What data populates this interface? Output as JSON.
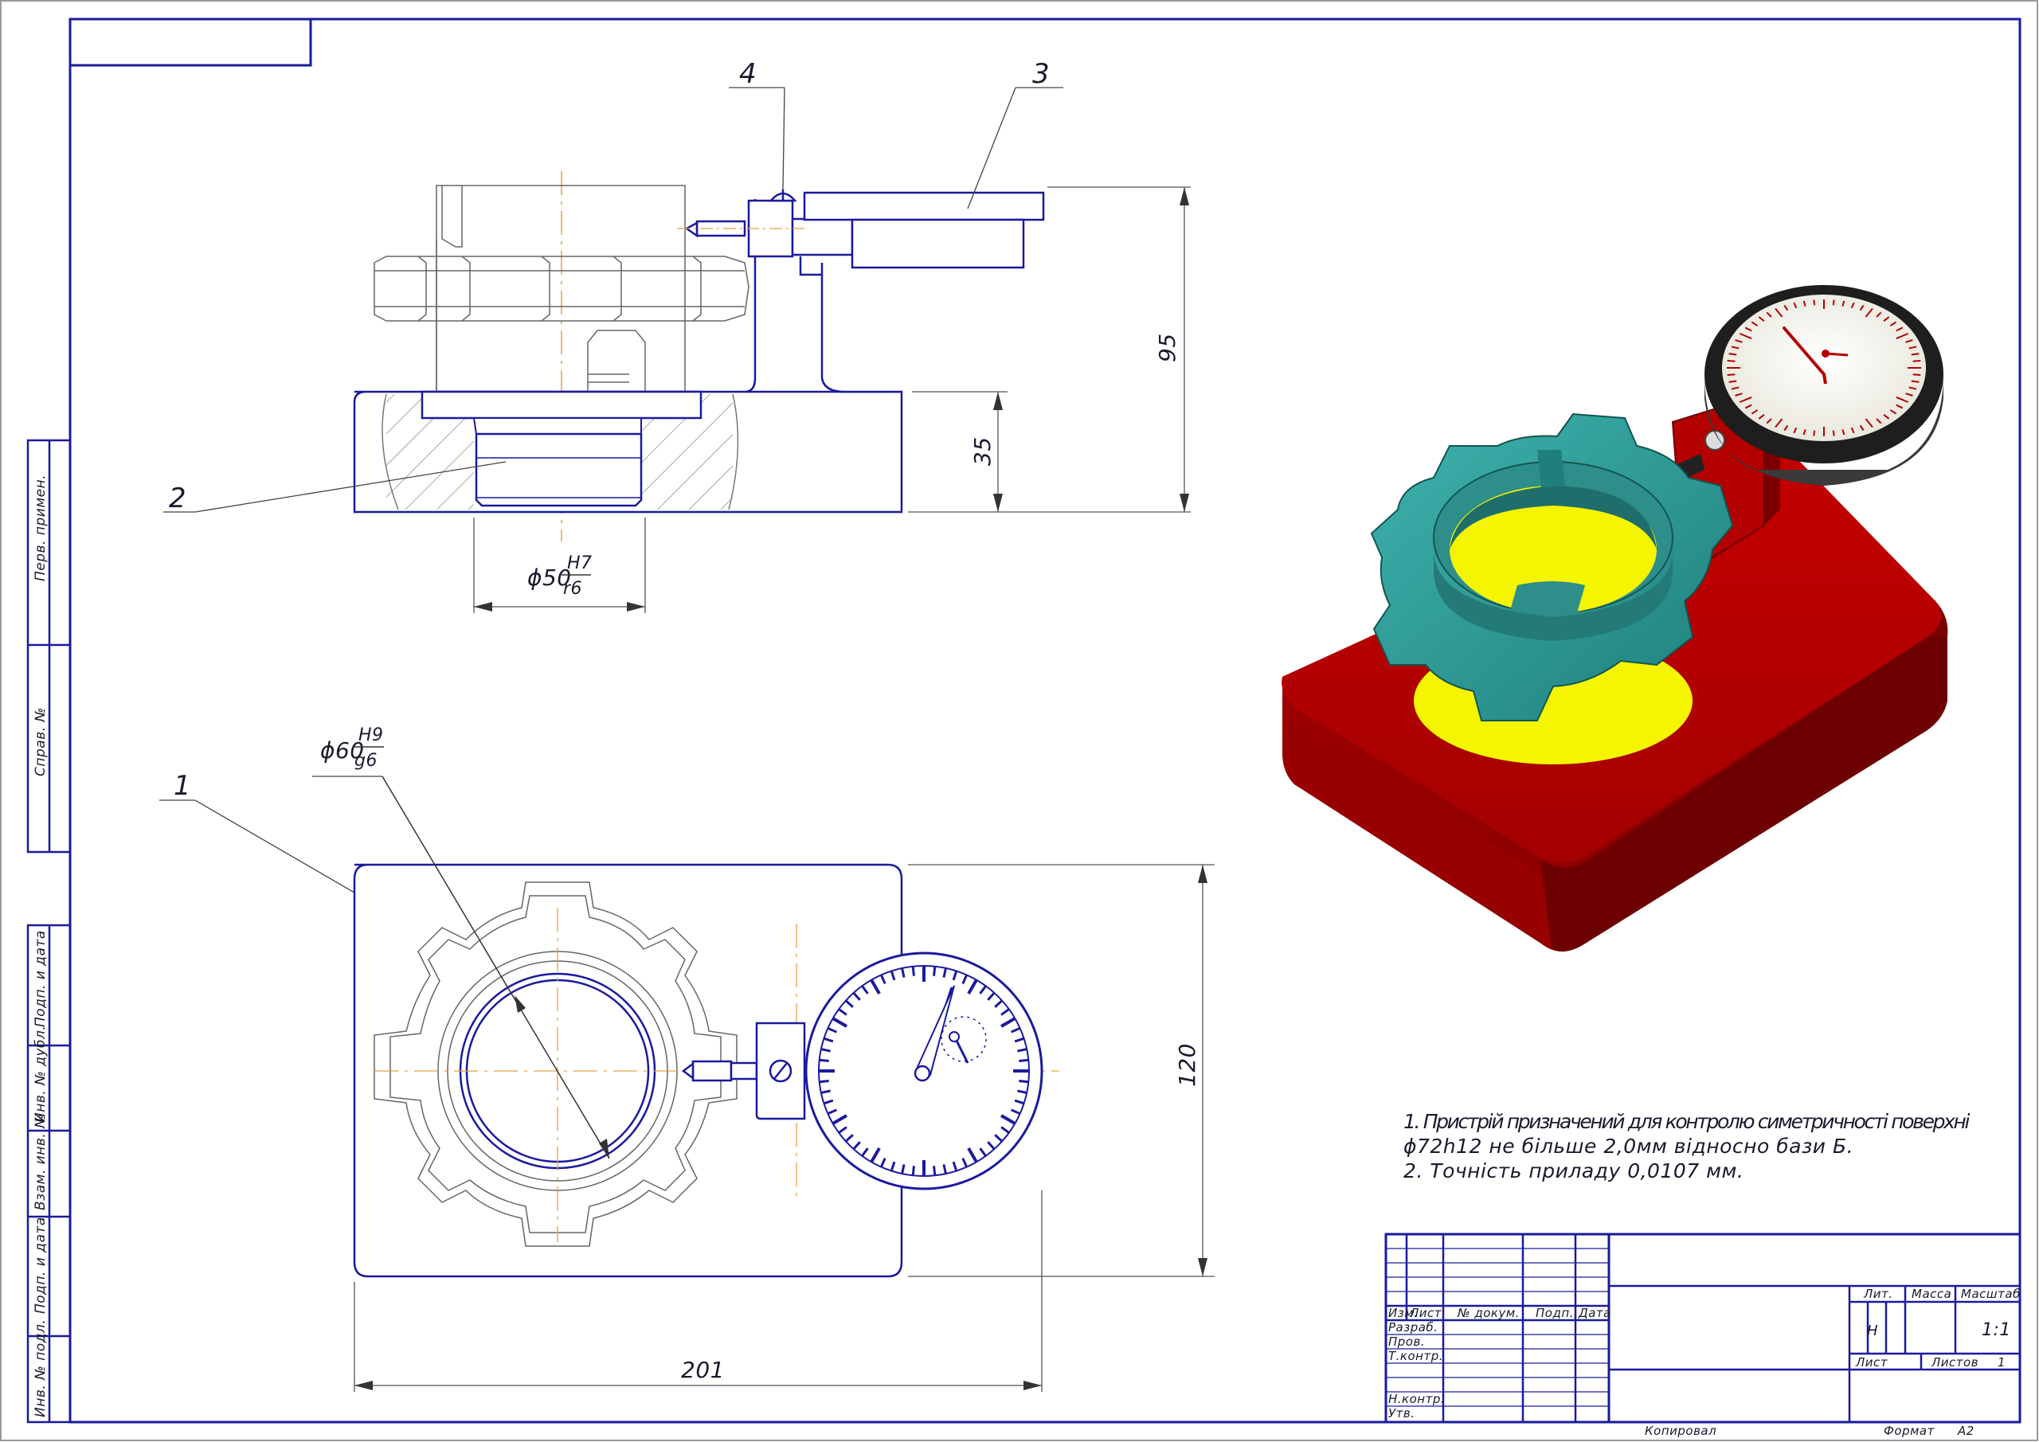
{
  "drawing": {
    "item_labels": [
      "1",
      "2",
      "3",
      "4"
    ],
    "dimensions": {
      "height_total": "95",
      "base_height": "35",
      "width_total": "201",
      "depth_total": "120",
      "bore_fit_main": "ϕ50",
      "bore_fit_top": "H7",
      "bore_fit_bottom": "r6",
      "ring_fit_main": "ϕ60",
      "ring_fit_top": "H9",
      "ring_fit_bottom": "g6"
    },
    "notes": [
      "1. Пристрій призначений для контролю симетричності поверхні",
      "ϕ72h12 не більше 2,0мм відносно бази Б.",
      "2. Точність приладу 0,0107 мм."
    ],
    "side_stamp": [
      "Перв. примен.",
      "Справ. №",
      "Подп. и дата",
      "Инв. № дубл.",
      "Взам. инв. №",
      "Подп. и дата",
      "Инв. № подл."
    ],
    "title_block": {
      "headers": [
        "Изм.",
        "Лист",
        "№ докум.",
        "Подп.",
        "Дата"
      ],
      "roles": [
        "Разраб.",
        "Пров.",
        "Т.контр.",
        "",
        "Н.контр.",
        "Утв."
      ],
      "lit_label": "Лит.",
      "mass_label": "Масса",
      "scale_label": "Масштаб",
      "lit_value": "Н",
      "scale_value": "1:1",
      "sheet_label": "Лист",
      "sheets_label": "Листов",
      "sheets_value": "1",
      "copied_label": "Копировал",
      "format_label": "Формат",
      "format_value": "А2"
    }
  },
  "colors": {
    "frame": "#1a1a9e",
    "line_thin": "#555555",
    "axis": "#e8a040",
    "base_red": "#b30000",
    "knob_teal": "#2a9d9a",
    "insert_yellow": "#f5f500",
    "gauge_dark": "#2b2b2b"
  }
}
